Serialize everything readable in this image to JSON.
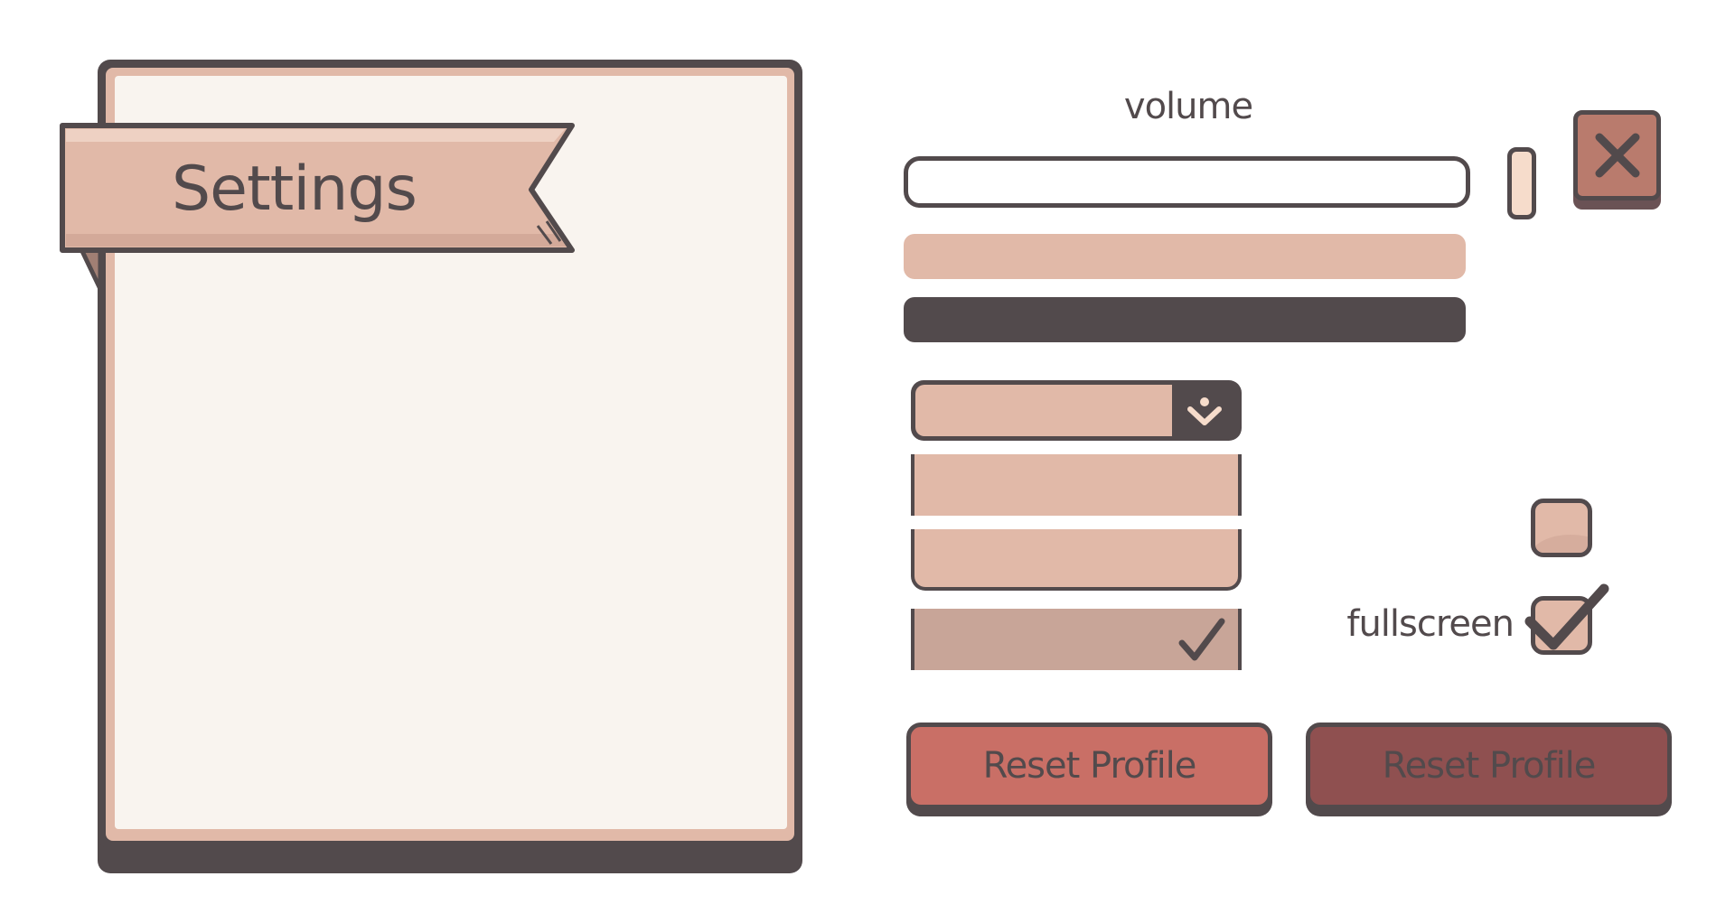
{
  "settings_panel": {
    "title": "Settings"
  },
  "volume": {
    "label": "volume",
    "slider_level": 1.0
  },
  "close_button": {
    "icon": "close-icon"
  },
  "dropdown": {
    "selected_value": "",
    "arrow_icon": "chevron-down-icon",
    "options": [
      "",
      "",
      ""
    ],
    "checked_option_index": 2
  },
  "fullscreen": {
    "label": "fullscreen",
    "checked": true
  },
  "buttons": {
    "reset_normal_label": "Reset Profile",
    "reset_pressed_label": "Reset Profile"
  },
  "colors": {
    "dark_outline": "#524a4c",
    "light_fill": "#e1b9a8",
    "panel_bg": "#f9f4ef",
    "button_primary": "#c96f66",
    "button_pressed": "#8f5050",
    "close_fill": "#b97b6d"
  }
}
